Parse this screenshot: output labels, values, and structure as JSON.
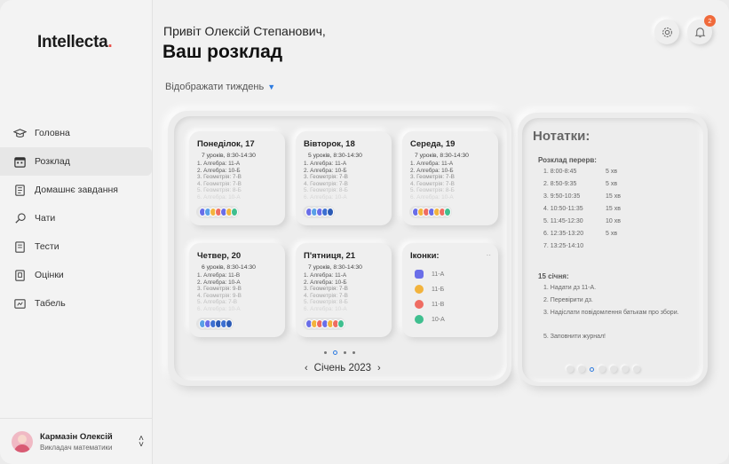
{
  "app": {
    "logo": "Intellecta",
    "logo_dot": "."
  },
  "sidebar": {
    "items": [
      {
        "label": "Головна",
        "icon": "graduation-cap-icon"
      },
      {
        "label": "Розклад",
        "icon": "calendar-icon",
        "active": true
      },
      {
        "label": "Домашнє завдання",
        "icon": "book-icon"
      },
      {
        "label": "Чати",
        "icon": "chat-icon"
      },
      {
        "label": "Тести",
        "icon": "test-icon"
      },
      {
        "label": "Оцінки",
        "icon": "grades-icon"
      },
      {
        "label": "Табель",
        "icon": "report-icon"
      }
    ],
    "user": {
      "name": "Кармазін Олексій",
      "role": "Викладач математики"
    }
  },
  "header": {
    "greeting": "Привіт Олексій Степанович,",
    "title": "Ваш розклад",
    "week_toggle": "Відображати тиждень",
    "notifications_count": "2"
  },
  "schedule": {
    "days": [
      {
        "title": "Понеділок, 17",
        "sub": "7 уроків,  8:30-14:30",
        "lessons": [
          "1. Алгебра: 11-А",
          "2. Алгебра: 10-Б",
          "3. Геометрія: 7-В",
          "4. Геометрія: 7-В",
          "5. Геометрія: 8-Б",
          "6. Алгебра: 10-А"
        ]
      },
      {
        "title": "Вівторок, 18",
        "sub": "5 уроків,  8:30-14:30",
        "lessons": [
          "1. Алгебра: 11-А",
          "2. Алгебра: 10-Б",
          "3. Геометрія: 7-В",
          "4. Геометрія: 7-В",
          "5. Геометрія: 8-Б",
          "6. Алгебра: 10-А"
        ]
      },
      {
        "title": "Середа, 19",
        "sub": "7 уроків,  8:30-14:30",
        "lessons": [
          "1. Алгебра: 11-А",
          "2. Алгебра: 10-Б",
          "3. Геометрія: 7-В",
          "4. Геометрія: 7-В",
          "5. Геометрія: 8-Б",
          "6. Алгебра: 10-А"
        ]
      },
      {
        "title": "Четвер, 20",
        "sub": "6 уроків,  8:30-14:30",
        "lessons": [
          "1. Алгебра: 11-В",
          "2. Алгебра: 10-А",
          "3. Геометрія: 9-В",
          "4. Геометрія: 9-В",
          "5. Алгебра: 7-В",
          "6. Алгебра: 10-А"
        ]
      },
      {
        "title": "П'ятниця, 21",
        "sub": "7 уроків,  8:30-14:30",
        "lessons": [
          "1. Алгебра: 11-А",
          "2. Алгебра: 10-Б",
          "3. Геометрія: 7-В",
          "4. Геометрія: 7-В",
          "5. Геометрія: 8-Б",
          "6. Алгебра: 10-А"
        ]
      }
    ],
    "legend": {
      "title": "Іконки:",
      "items": [
        {
          "label": "11-А",
          "color": "#6a6ee8"
        },
        {
          "label": "11-Б",
          "color": "#f2b33d"
        },
        {
          "label": "11-В",
          "color": "#ef6c62"
        },
        {
          "label": "10-А",
          "color": "#3fbf8f"
        }
      ]
    },
    "month": "Січень 2023"
  },
  "notes": {
    "title": "Нотатки:",
    "breaks_title": "Розклад перерв:",
    "breaks": [
      {
        "time": "1. 8:00-8:45",
        "dur": "5 хв"
      },
      {
        "time": "2. 8:50-9:35",
        "dur": "5 хв"
      },
      {
        "time": "3. 9:50-10:35",
        "dur": "15 хв"
      },
      {
        "time": "4. 10:50-11:35",
        "dur": "15 хв"
      },
      {
        "time": "5. 11:45-12:30",
        "dur": "10 хв"
      },
      {
        "time": "6. 12:35-13:20",
        "dur": "5 хв"
      },
      {
        "time": "7. 13:25-14:10",
        "dur": ""
      }
    ],
    "date_title": "15 січня:",
    "todos": [
      "1. Надати дз 11-А.",
      "2. Перевірити дз.",
      "3. Надіслати повідомлення батькам про збори.",
      "5. Заповнити журнал!"
    ]
  },
  "colors": {
    "accent": "#2d7be0",
    "badge": "#f06a3b",
    "logo_dot": "#e8514a"
  }
}
